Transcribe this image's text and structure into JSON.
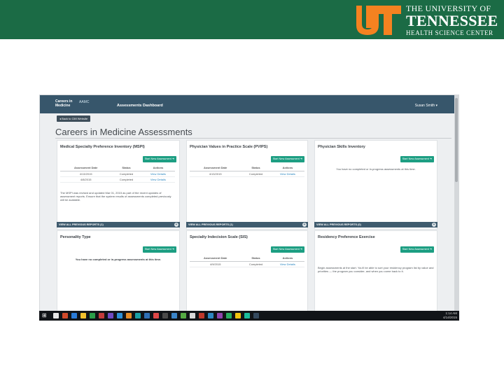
{
  "banner": {
    "line1": "THE UNIVERSITY OF",
    "line2": "TENNESSEE",
    "line3": "HEALTH SCIENCE CENTER",
    "colors": {
      "background": "#1b6b45",
      "logo": "#f58220",
      "text": "#ffffff"
    }
  },
  "app": {
    "brand_line1": "Careers in",
    "brand_line2": "Medicine",
    "brand_mark": "AAMC",
    "nav_dashboard": "Assessments Dashboard",
    "user_menu": "Susan Smith ▾",
    "back_button": "◂ Back to CiM Website",
    "page_title": "Careers in Medicine Assessments",
    "colors": {
      "appbar": "#37566b",
      "button": "#1c9e82",
      "link": "#2a86c0",
      "previous_bar": "#3f5b6e"
    }
  },
  "cards": {
    "msp": {
      "title": "Medical Specialty Preference Inventory (MSPI)",
      "start_button": "Start New Assessment ➜",
      "headers": [
        "Assessment Date",
        "Status",
        "Actions"
      ],
      "rows": [
        {
          "date": "4/13/2015",
          "status": "Completed",
          "action": "View Details"
        },
        {
          "date": "4/8/2015",
          "status": "Completed",
          "action": "View Details"
        }
      ],
      "note": "The MSPI was revised and updated Mar 01, 2015 as part of the recent updates of assessment reports. Ensure that the system results of assessments completed previously will be available.",
      "previous_bar": "VIEW ALL PREVIOUS REPORTS (1)"
    },
    "pvps": {
      "title": "Physician Values in Practice Scale (PVIPS)",
      "start_button": "Start New Assessment ➜",
      "headers": [
        "Assessment Date",
        "Status",
        "Actions"
      ],
      "rows": [
        {
          "date": "4/13/2015",
          "status": "Completed",
          "action": "View Details"
        }
      ],
      "previous_bar": "VIEW ALL PREVIOUS REPORTS (1)"
    },
    "psi": {
      "title": "Physician Skills Inventory",
      "start_button": "Start New Assessment ➜",
      "note": "You have no completed or in-progress assessments at this time.",
      "previous_bar": "VIEW ALL PREVIOUS REPORTS (0)"
    },
    "personality": {
      "title": "Personality Type",
      "start_button": "Start New Assessment ➜",
      "note": "You have no completed or in-progress assessments at this time."
    },
    "sis": {
      "title": "Specialty Indecision Scale (SIS)",
      "start_button": "Start New Assessment ➜",
      "headers": [
        "Assessment Date",
        "Status",
        "Actions"
      ],
      "rows": [
        {
          "date": "4/9/2015",
          "status": "Completed",
          "action": "View Details"
        }
      ]
    },
    "residency": {
      "title": "Residency Preference Exercise",
      "start_button": "Start New Assessment ➜",
      "note": "Begin assessments at the start. You'll be able to sort your residency program list by value and priorities — the program you consider, and when you come back to it."
    }
  },
  "taskbar": {
    "time": "1:14 AM",
    "date": "4/14/2015",
    "app_icons": [
      "#e7e7e7",
      "#d04a2b",
      "#2a7bd8",
      "#f2c12e",
      "#2b9e49",
      "#c43b3b",
      "#6f4ac2",
      "#2c8fd6",
      "#e48b25",
      "#19a0a6",
      "#2f6fb5",
      "#e04848",
      "#4a4a4a",
      "#3b85c9",
      "#55aa44",
      "#d9d9d9",
      "#c0392b",
      "#2e86c1",
      "#8e44ad",
      "#27ae60",
      "#f1c40f",
      "#1abc9c",
      "#34495e"
    ]
  }
}
